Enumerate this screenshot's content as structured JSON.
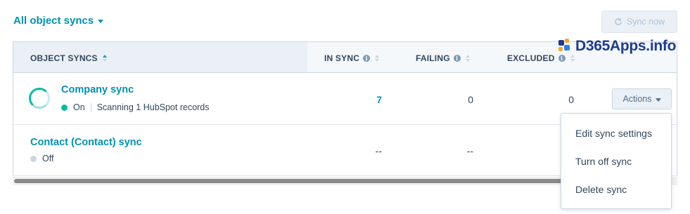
{
  "filter": {
    "label": "All object syncs"
  },
  "toolbar": {
    "sync_now_label": "Sync now"
  },
  "table": {
    "headers": {
      "object_syncs": "OBJECT SYNCS",
      "in_sync": "IN SYNC",
      "failing": "FAILING",
      "excluded": "EXCLUDED"
    },
    "rows": [
      {
        "name": "Company sync",
        "status": "On",
        "detail": "Scanning 1 HubSpot records",
        "in_sync": "7",
        "failing": "0",
        "excluded": "0",
        "actions_label": "Actions"
      },
      {
        "name": "Contact (Contact) sync",
        "status": "Off",
        "in_sync": "--",
        "failing": "--"
      }
    ]
  },
  "menu": {
    "items": [
      "Edit sync settings",
      "Turn off sync",
      "Delete sync"
    ]
  },
  "watermark": {
    "text": "D365Apps.info"
  },
  "colors": {
    "accent": "#0091ae",
    "on": "#00bda5",
    "off": "#cbd6e2",
    "header_bg": "#f5f8fa"
  }
}
